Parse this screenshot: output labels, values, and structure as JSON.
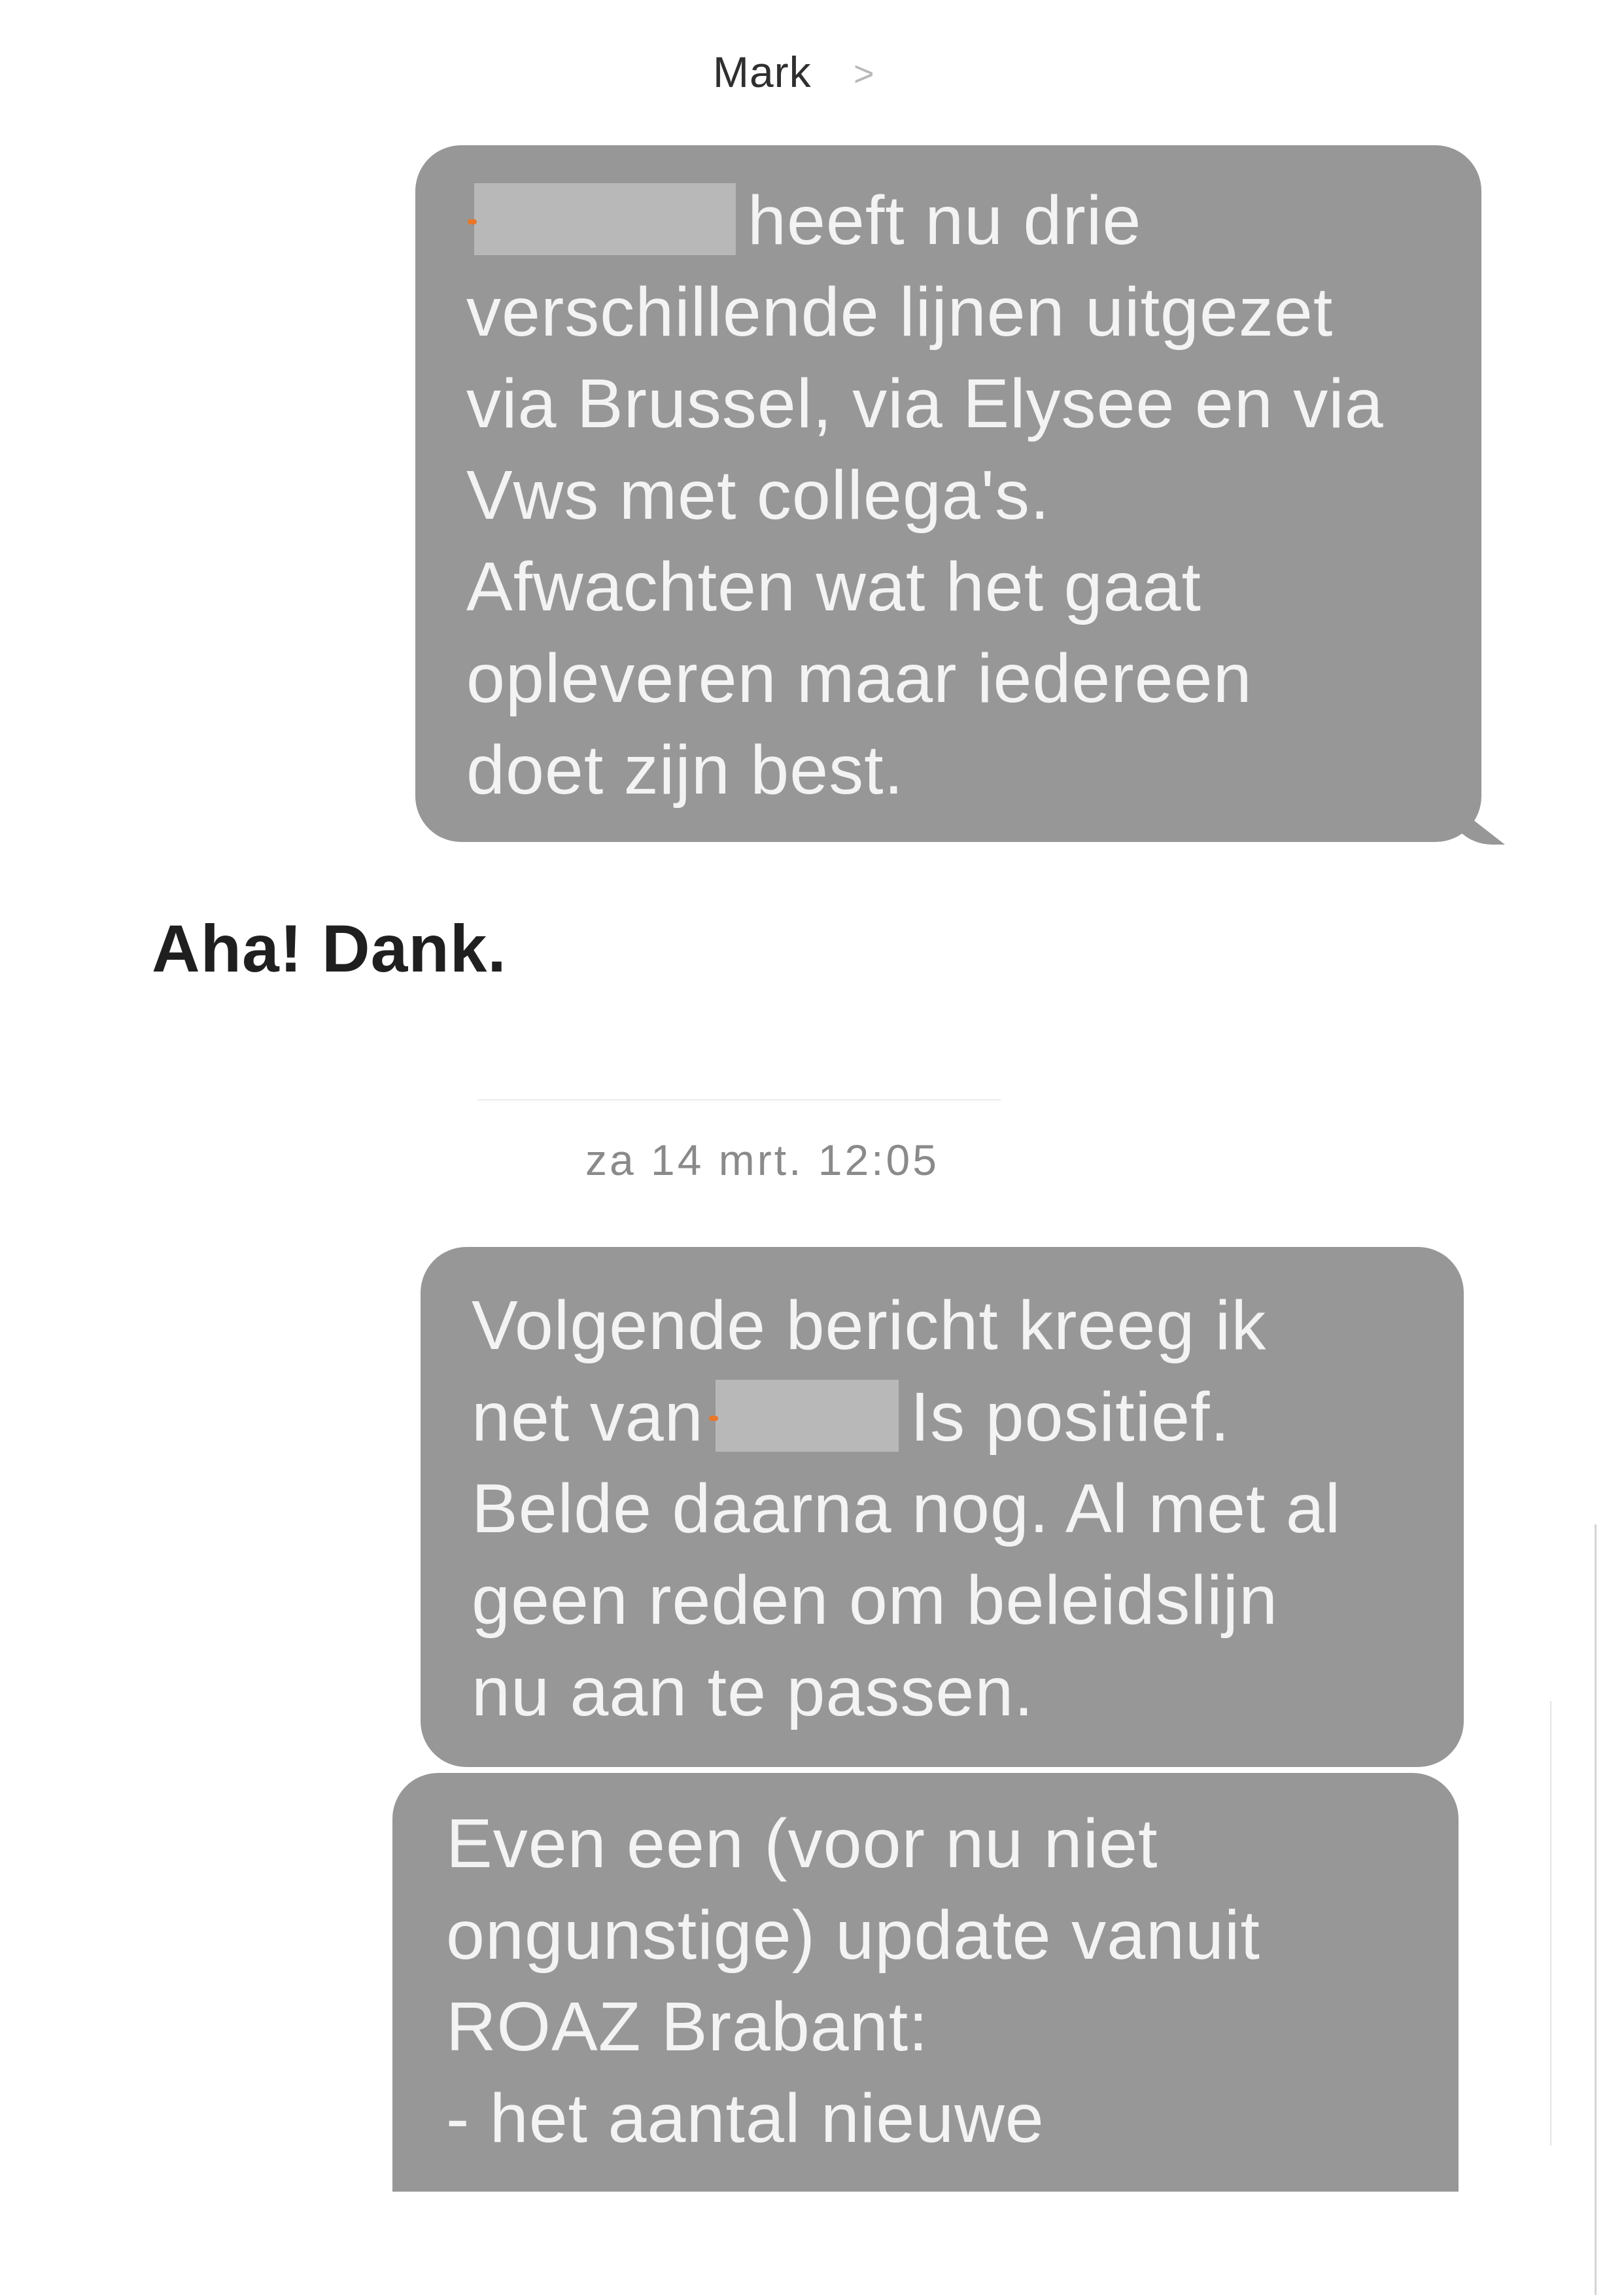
{
  "header": {
    "contact_name": "Mark",
    "chevron": ">"
  },
  "messages": [
    {
      "direction": "incoming",
      "text_after_redaction": "heeft nu drie\nverschillende lijnen uitgezet\nvia Brussel, via Elysee en via\nVws met collega's.\nAfwachten wat het gaat\nopleveren maar iedereen\ndoet zijn best."
    },
    {
      "direction": "outgoing",
      "text": "Aha! Dank."
    },
    {
      "timestamp": "za 14 mrt. 12:05"
    },
    {
      "direction": "incoming",
      "text_before_redaction": "Volgende bericht kreeg ik\nnet van",
      "text_after_redaction": "Is positief.\nBelde daarna nog. Al met al\ngeen reden om beleidslijn\nnu aan te passen."
    },
    {
      "direction": "incoming",
      "text": "Even een (voor nu niet\nongunstige) update vanuit\nROAZ Brabant:\n- het aantal nieuwe"
    }
  ],
  "colors": {
    "bubble": "#979797",
    "bubble_text": "#f3f3f3",
    "redaction": "#b8b8b8",
    "redaction_marker": "#e8772a"
  }
}
